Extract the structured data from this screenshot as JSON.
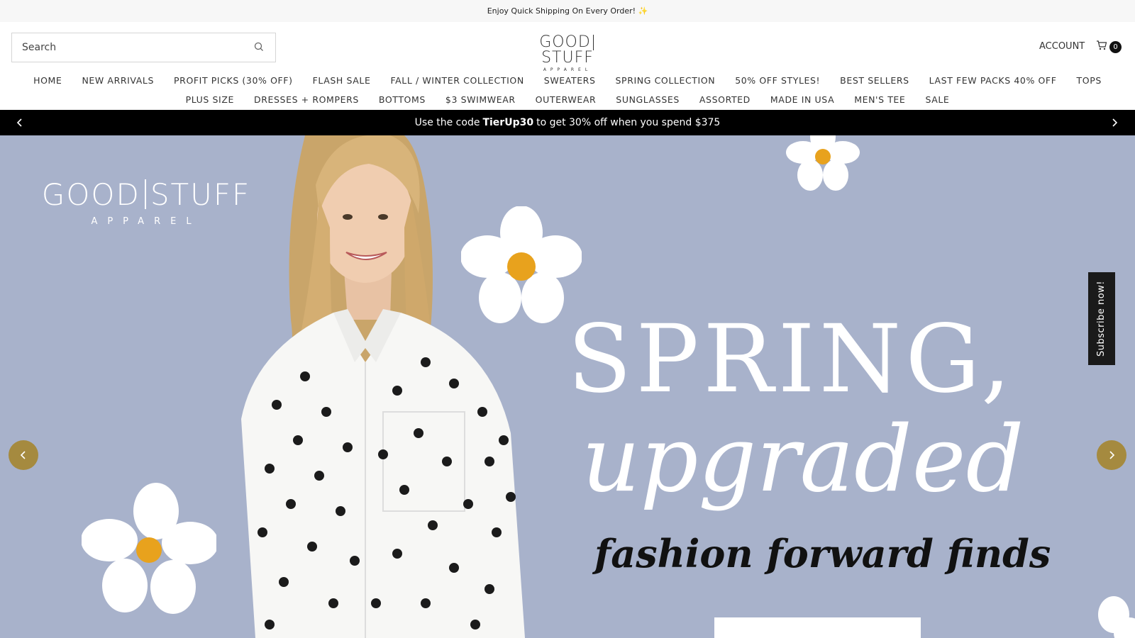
{
  "announcement": {
    "text": "Enjoy Quick Shipping On Every Order! ✨"
  },
  "header": {
    "search": {
      "placeholder": "Search"
    },
    "logo": {
      "main_left": "GOOD",
      "main_right": "STUFF",
      "sub": "APPAREL"
    },
    "account_label": "ACCOUNT",
    "cart_count": "0"
  },
  "nav": {
    "row1": [
      "HOME",
      "NEW ARRIVALS",
      "PROFIT PICKS (30% OFF)",
      "FLASH SALE",
      "FALL / WINTER COLLECTION",
      "SWEATERS",
      "SPRING COLLECTION",
      "50% OFF STYLES!",
      "BEST SELLERS",
      "LAST FEW PACKS 40% OFF",
      "TOPS"
    ],
    "row2": [
      "PLUS SIZE",
      "DRESSES + ROMPERS",
      "BOTTOMS",
      "$3 SWIMWEAR",
      "OUTERWEAR",
      "SUNGLASSES",
      "ASSORTED",
      "MADE IN USA",
      "MEN'S TEE",
      "SALE"
    ]
  },
  "promo": {
    "prefix": "Use the code",
    "code": "TierUp30",
    "suffix": "to get 30% off when you spend $375"
  },
  "hero": {
    "logo_main_left": "GOOD",
    "logo_main_right": "STUFF",
    "logo_sub": "APPAREL",
    "headline_1": "SPRING,",
    "headline_2": "upgraded",
    "tagline": "fashion forward finds",
    "subscribe_label": "Subscribe now!"
  },
  "colors": {
    "hero_bg": "#a8b2cb",
    "slide_arrow": "#a58a3f",
    "flower_center": "#e8a21d",
    "promo_bg": "#000000"
  },
  "icons": [
    "search-icon",
    "cart-icon",
    "chevron-left-icon",
    "chevron-right-icon"
  ]
}
